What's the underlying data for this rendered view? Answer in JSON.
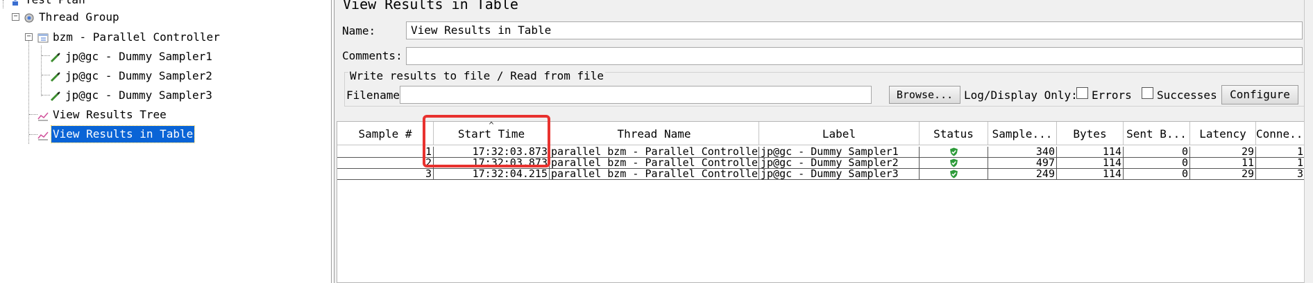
{
  "tree": {
    "items": [
      {
        "label": "Test Plan",
        "icon": "test-plan-icon"
      },
      {
        "label": "Thread Group",
        "icon": "gear-icon"
      },
      {
        "label": "bzm - Parallel Controller",
        "icon": "controller-icon"
      },
      {
        "label": "jp@gc - Dummy Sampler1",
        "icon": "pipette-icon"
      },
      {
        "label": "jp@gc - Dummy Sampler2",
        "icon": "pipette-icon"
      },
      {
        "label": "jp@gc - Dummy Sampler3",
        "icon": "pipette-icon"
      },
      {
        "label": "View Results Tree",
        "icon": "chart-icon"
      },
      {
        "label": "View Results in Table",
        "icon": "chart-icon"
      }
    ],
    "selected": "View Results in Table"
  },
  "panel": {
    "title": "View Results in Table",
    "name_label": "Name:",
    "name_value": "View Results in Table",
    "comments_label": "Comments:",
    "comments_value": "",
    "group_title": "Write results to file / Read from file",
    "filename_label": "Filename",
    "filename_value": "",
    "browse_label": "Browse...",
    "log_display_label": "Log/Display Only:",
    "errors_label": "Errors",
    "successes_label": "Successes",
    "configure_label": "Configure"
  },
  "table": {
    "columns": [
      "Sample #",
      "Start Time",
      "Thread Name",
      "Label",
      "Status",
      "Sample...",
      "Bytes",
      "Sent B...",
      "Latency",
      "Conne..."
    ],
    "sort_column": "Start Time",
    "rows": [
      {
        "sample": "1",
        "start": "17:32:03.873",
        "thread": "parallel bzm - Parallel Controller",
        "label": "jp@gc - Dummy Sampler1",
        "status": "success",
        "sample_time": "340",
        "bytes": "114",
        "sent": "0",
        "latency": "29",
        "connect": "1"
      },
      {
        "sample": "2",
        "start": "17:32:03.873",
        "thread": "parallel bzm - Parallel Controller",
        "label": "jp@gc - Dummy Sampler2",
        "status": "success",
        "sample_time": "497",
        "bytes": "114",
        "sent": "0",
        "latency": "11",
        "connect": "1"
      },
      {
        "sample": "3",
        "start": "17:32:04.215",
        "thread": "parallel bzm - Parallel Controller",
        "label": "jp@gc - Dummy Sampler3",
        "status": "success",
        "sample_time": "249",
        "bytes": "114",
        "sent": "0",
        "latency": "29",
        "connect": "3"
      }
    ]
  },
  "colors": {
    "selection": "#0a64d6",
    "highlight": "#e8322f",
    "success": "#2e9b3a"
  }
}
